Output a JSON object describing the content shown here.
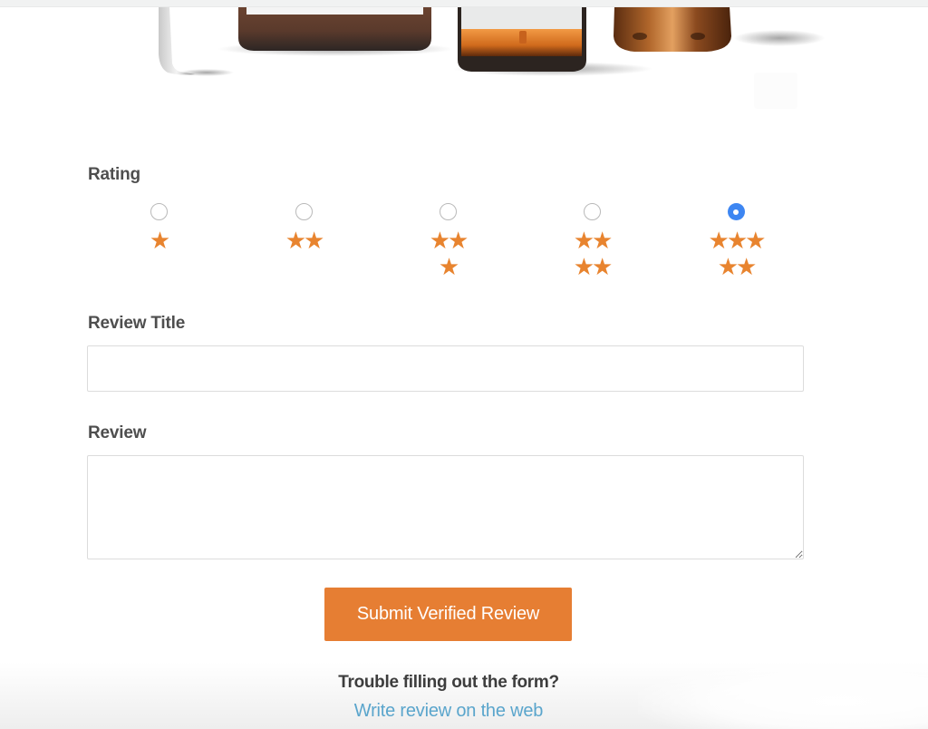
{
  "product_image": {
    "alt": "Product bottles and jars"
  },
  "rating": {
    "label": "Rating",
    "selected": 5,
    "max": 5,
    "options": [
      {
        "value": 1,
        "rows": [
          "★"
        ]
      },
      {
        "value": 2,
        "rows": [
          "★★"
        ]
      },
      {
        "value": 3,
        "rows": [
          "★★",
          "★"
        ]
      },
      {
        "value": 4,
        "rows": [
          "★★",
          "★★"
        ]
      },
      {
        "value": 5,
        "rows": [
          "★★★",
          "★★"
        ]
      }
    ]
  },
  "review_title": {
    "label": "Review Title",
    "value": "",
    "placeholder": ""
  },
  "review": {
    "label": "Review",
    "value": "",
    "placeholder": ""
  },
  "submit": {
    "label": "Submit Verified Review"
  },
  "footer": {
    "trouble_text": "Trouble filling out the form?",
    "link_text": "Write review on the web"
  },
  "colors": {
    "accent": "#e67e33",
    "star": "#e8842f",
    "radio_checked": "#3d86f2",
    "link": "#5aa5cc",
    "label": "#4e4e4e"
  }
}
